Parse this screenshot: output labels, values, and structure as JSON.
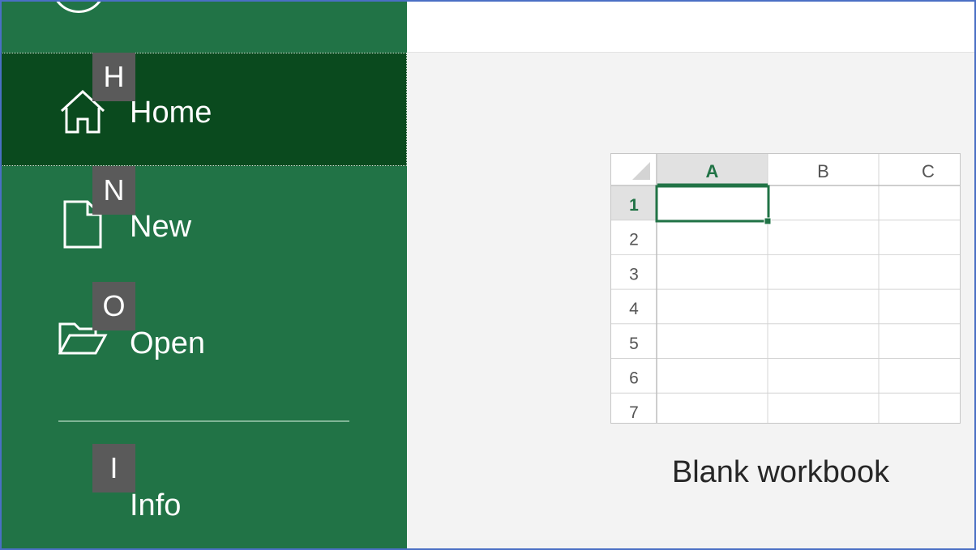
{
  "sidebar": {
    "items": [
      {
        "label": "Home",
        "keytip": "H",
        "icon": "home-icon"
      },
      {
        "label": "New",
        "keytip": "N",
        "icon": "new-document-icon"
      },
      {
        "label": "Open",
        "keytip": "O",
        "icon": "open-folder-icon"
      },
      {
        "label": "Info",
        "keytip": "I"
      }
    ]
  },
  "template": {
    "caption": "Blank workbook",
    "columns": [
      "A",
      "B",
      "C"
    ],
    "rows": [
      "1",
      "2",
      "3",
      "4",
      "5",
      "6",
      "7"
    ],
    "selected_cell": "A1"
  },
  "colors": {
    "sidebar_bg": "#217346",
    "sidebar_selected": "#0a4a1e",
    "accent_green": "#217346",
    "keytip_bg": "#5a5a5a"
  }
}
